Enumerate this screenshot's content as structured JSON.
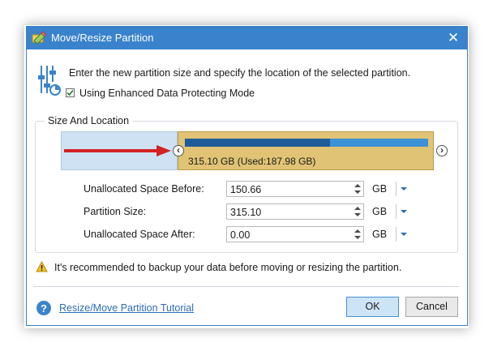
{
  "window": {
    "title": "Move/Resize Partition",
    "title_bar_color": "#3a83cc"
  },
  "header": {
    "instruction": "Enter the new partition size and specify the location of the selected partition.",
    "checkbox_label": "Using Enhanced Data Protecting Mode",
    "checkbox_checked": true
  },
  "size_location": {
    "group_title": "Size And Location",
    "partition_label": "315.10 GB (Used:187.98 GB)",
    "used_fraction": 0.597
  },
  "fields": [
    {
      "label": "Unallocated Space Before:",
      "value": "150.66",
      "unit": "GB"
    },
    {
      "label": "Partition Size:",
      "value": "315.10",
      "unit": "GB"
    },
    {
      "label": "Unallocated Space After:",
      "value": "0.00",
      "unit": "GB"
    }
  ],
  "warning": "It's recommended to backup your data before moving or resizing the partition.",
  "footer": {
    "tutorial_link": "Resize/Move Partition Tutorial",
    "ok_label": "OK",
    "cancel_label": "Cancel"
  },
  "icons": {
    "app": "move-resize-icon",
    "close": "close-icon",
    "settings": "sliders-icon",
    "warning": "warning-icon",
    "help": "help-icon"
  }
}
